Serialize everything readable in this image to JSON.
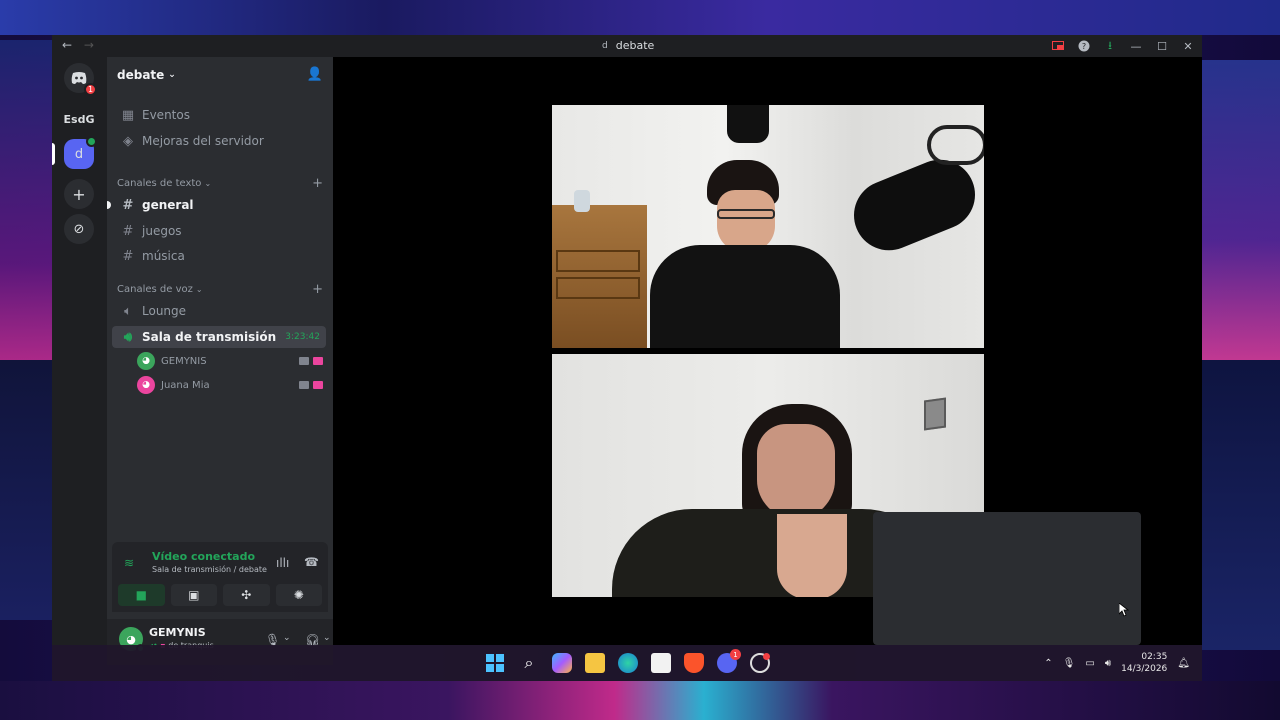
{
  "window": {
    "title": "debate",
    "title_badge": "d",
    "back": "←",
    "forward": "→"
  },
  "guilds": {
    "home_notifications": "1",
    "esdg_label": "EsdG",
    "d_label": "d",
    "add_label": "+",
    "explore_label": "⊘"
  },
  "server": {
    "name": "debate",
    "items": [
      {
        "label": "Eventos",
        "icon": "calendar-icon"
      },
      {
        "label": "Mejoras del servidor",
        "icon": "boost-icon"
      }
    ],
    "text_category": "Canales de texto",
    "text_channels": [
      "general",
      "juegos",
      "música"
    ],
    "voice_category": "Canales de voz",
    "voice_channels": [
      {
        "label": "Lounge"
      },
      {
        "label": "Sala de transmisión",
        "timer": "3:23:42"
      }
    ],
    "members": [
      {
        "name": "GEMYNIS",
        "color": "#3ba55c"
      },
      {
        "name": "Juana Mia",
        "color": "#eb459e"
      }
    ]
  },
  "voice_panel": {
    "status": "Vídeo conectado",
    "location": "Sala de transmisión / debate"
  },
  "user": {
    "name": "GEMYNIS",
    "status": "de tranquis"
  },
  "taskbar": {
    "time": "02:35",
    "date": "14/3/2026",
    "discord_badge": "1"
  },
  "colors": {
    "accent": "#5865f2",
    "online": "#23a55a",
    "live": "#eb459e",
    "notification": "#f23f43"
  }
}
